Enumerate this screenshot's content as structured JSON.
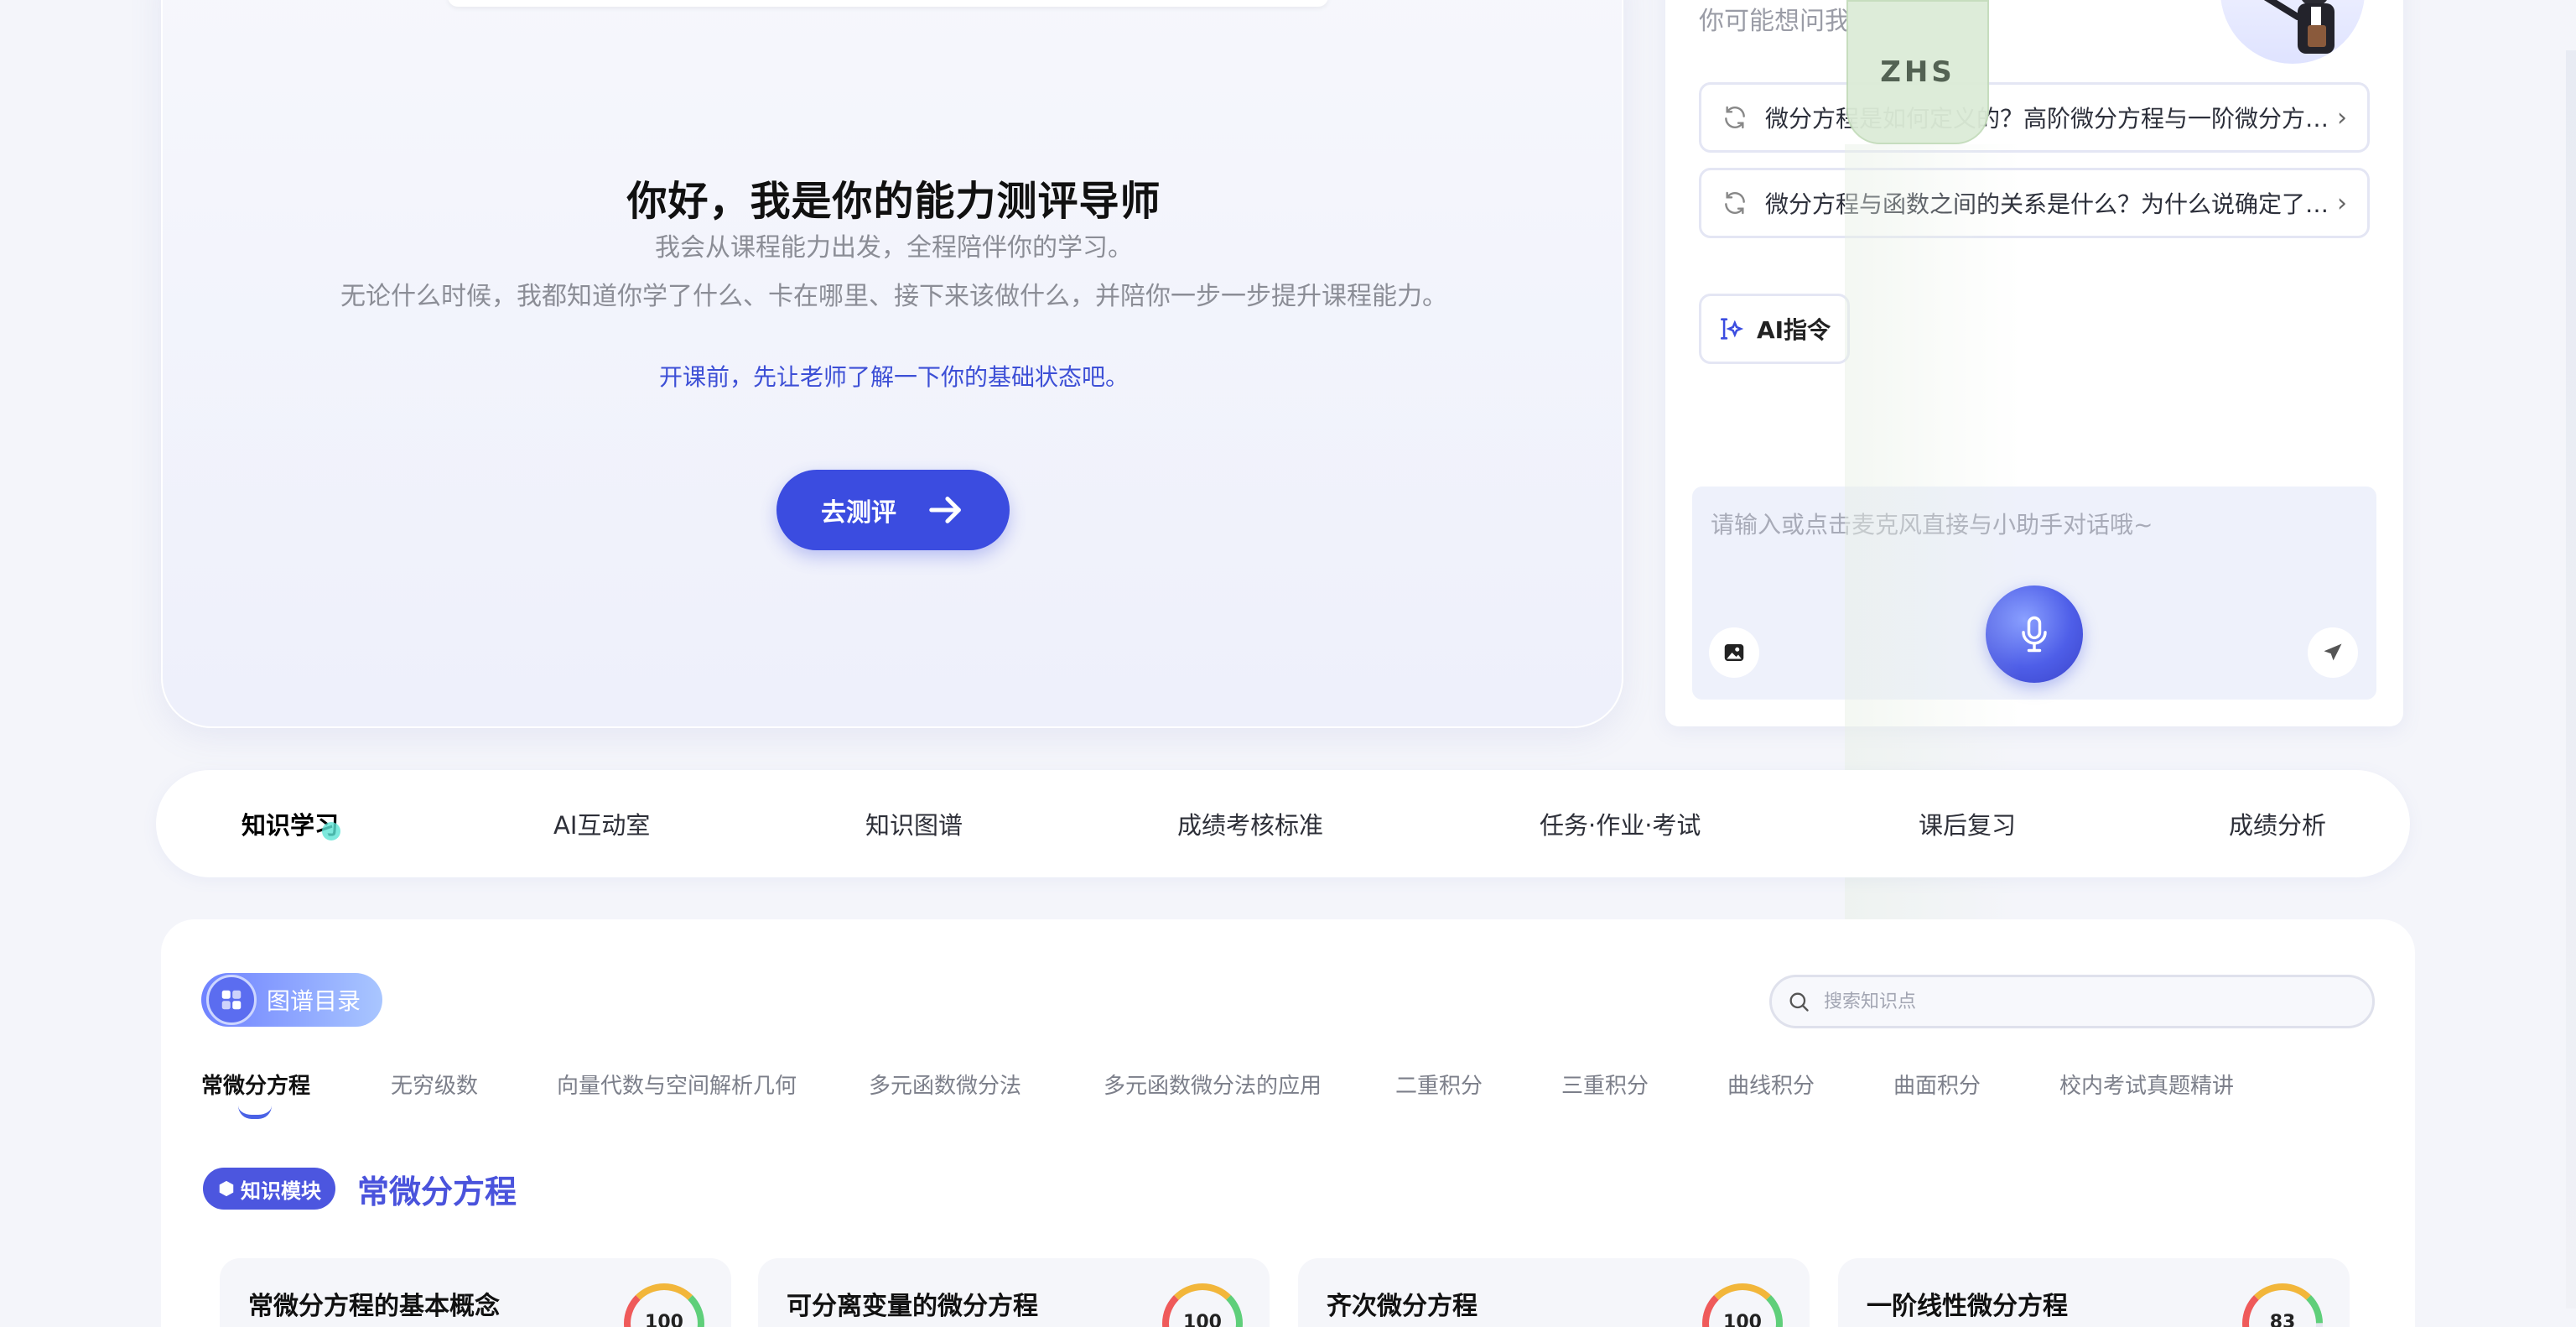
{
  "hero": {
    "title": "你好，我是你的能力测评导师",
    "line1": "我会从课程能力出发，全程陪伴你的学习。",
    "line2": "无论什么时候，我都知道你学了什么、卡在哪里、接下来该做什么，并陪你一步一步提升课程能力。",
    "note": "开课前，先让老师了解一下你的基础状态吧。",
    "button_label": "去测评"
  },
  "assistant": {
    "hint": "你可能想问我",
    "suggestions": [
      "微分方程是如何定义的？高阶微分方程与一阶微分方程有什么区别？",
      "微分方程与函数之间的关系是什么？为什么说确定了微分方程就确定了函数？"
    ],
    "ai_command_label": "AI指令",
    "input_placeholder": "请输入或点击麦克风直接与小助手对话哦~"
  },
  "overlay": {
    "badge": "ZHS"
  },
  "tabs": [
    {
      "label": "知识学习",
      "active": true
    },
    {
      "label": "AI互动室",
      "active": false
    },
    {
      "label": "知识图谱",
      "active": false
    },
    {
      "label": "成绩考核标准",
      "active": false
    },
    {
      "label": "任务·作业·考试",
      "active": false
    },
    {
      "label": "课后复习",
      "active": false
    },
    {
      "label": "成绩分析",
      "active": false
    }
  ],
  "content": {
    "category_chip": "图谱目录",
    "search_placeholder": "搜索知识点",
    "chapters": [
      "常微分方程",
      "无穷级数",
      "向量代数与空间解析几何",
      "多元函数微分法",
      "多元函数微分法的应用",
      "二重积分",
      "三重积分",
      "曲线积分",
      "曲面积分",
      "校内考试真题精讲"
    ],
    "module_tag": "知识模块",
    "module_title": "常微分方程",
    "cards": [
      {
        "title": "常微分方程的基本概念",
        "score": "100",
        "pct": 100
      },
      {
        "title": "可分离变量的微分方程",
        "score": "100",
        "pct": 100
      },
      {
        "title": "齐次微分方程",
        "score": "100",
        "pct": 100
      },
      {
        "title": "一阶线性微分方程",
        "score": "83",
        "pct": 83
      }
    ]
  },
  "colors": {
    "accent": "#3b4ce0",
    "module": "#4a53dc",
    "badge_bg": "#dcecd7"
  }
}
